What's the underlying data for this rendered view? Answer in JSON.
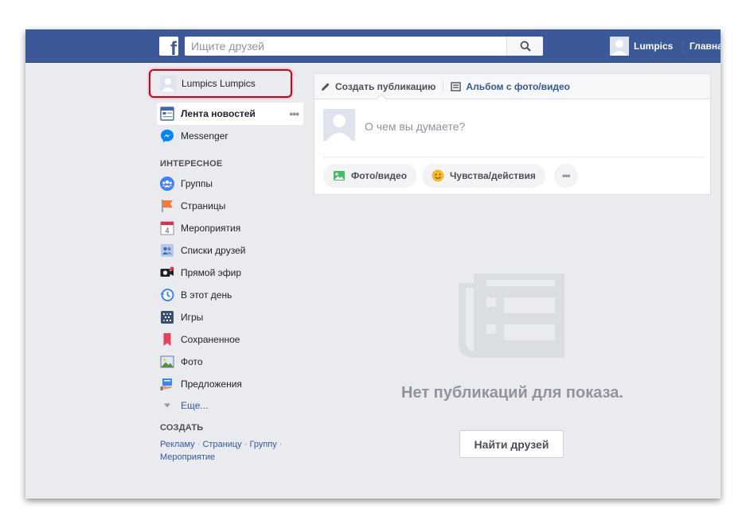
{
  "topbar": {
    "logo": "f",
    "search_placeholder": "Ищите друзей",
    "username": "Lumpics",
    "home": "Главная"
  },
  "sidebar": {
    "profile_name": "Lumpics Lumpics",
    "feed_label": "Лента новостей",
    "feed_more": "•••",
    "messenger_label": "Messenger",
    "interesting_title": "ИНТЕРЕСНОЕ",
    "items": [
      {
        "label": "Группы",
        "icon": "groups-icon"
      },
      {
        "label": "Страницы",
        "icon": "pages-flag-icon"
      },
      {
        "label": "Мероприятия",
        "icon": "calendar-icon",
        "badge": "4"
      },
      {
        "label": "Списки друзей",
        "icon": "friend-lists-icon"
      },
      {
        "label": "Прямой эфир",
        "icon": "live-camera-icon"
      },
      {
        "label": "В этот день",
        "icon": "on-this-day-icon"
      },
      {
        "label": "Игры",
        "icon": "games-icon"
      },
      {
        "label": "Сохраненное",
        "icon": "saved-bookmark-icon"
      },
      {
        "label": "Фото",
        "icon": "photos-icon"
      },
      {
        "label": "Предложения",
        "icon": "offers-icon"
      }
    ],
    "more_label": "Еще...",
    "create_title": "СОЗДАТЬ",
    "create_links": [
      "Рекламу",
      "Страницу",
      "Группу",
      "Мероприятие"
    ],
    "create_sep": "·"
  },
  "composer": {
    "tab_create": "Создать публикацию",
    "tab_album": "Альбом с фото/видео",
    "prompt": "О чем вы думаете?",
    "photo_video": "Фото/видео",
    "feelings": "Чувства/действия",
    "more": "•••"
  },
  "empty": {
    "message": "Нет публикаций для показа.",
    "find_friends": "Найти друзей"
  },
  "colors": {
    "brand": "#3b5998",
    "highlight": "#d0021b",
    "link": "#365899"
  }
}
